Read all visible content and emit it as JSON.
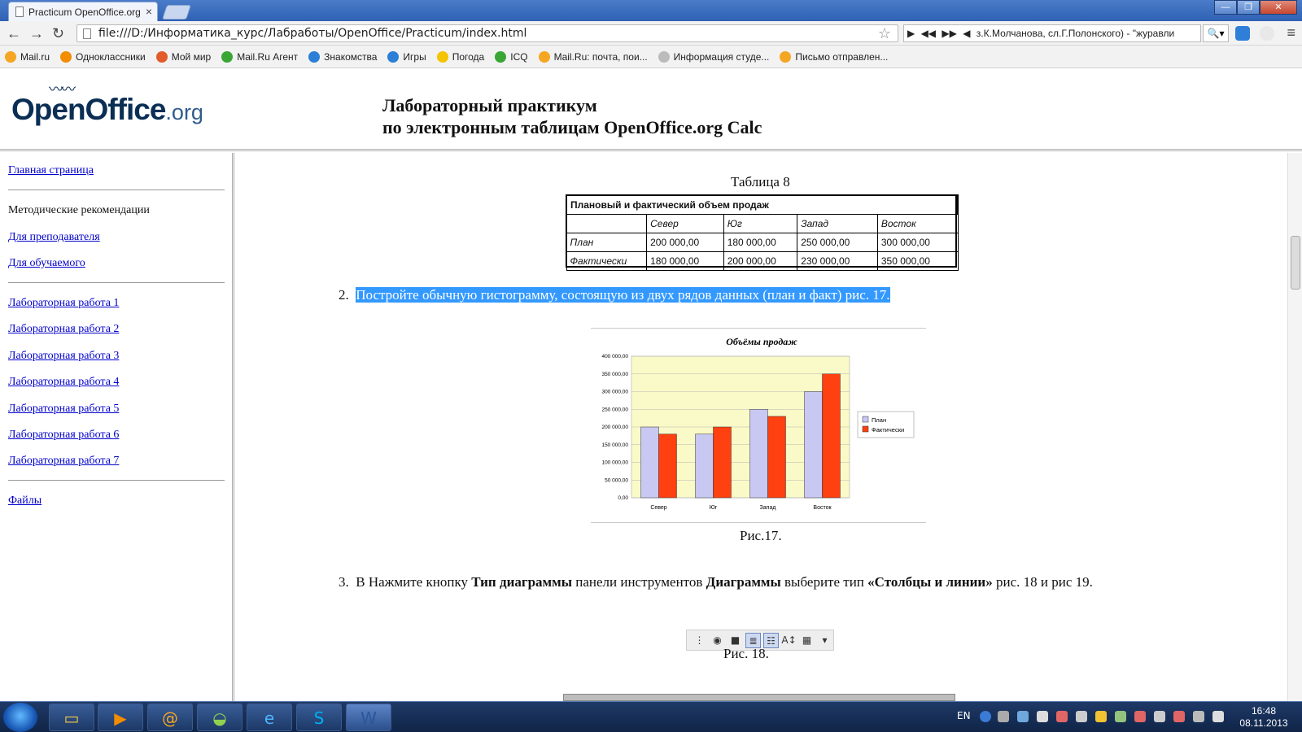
{
  "browser": {
    "tab_title": "Practicum OpenOffice.org",
    "url": "file:///D:/Информатика_курс/Лабработы/OpenOffice/Practicum/index.html",
    "media_text": "з.К.Молчанова, сл.Г.Полонского) - \"журавли"
  },
  "bookmarks": [
    {
      "label": "Mail.ru",
      "color": "#f5a623"
    },
    {
      "label": "Одноклассники",
      "color": "#f28c00"
    },
    {
      "label": "Мой мир",
      "color": "#e25c2b"
    },
    {
      "label": "Mail.Ru Агент",
      "color": "#3aa635"
    },
    {
      "label": "Знакомства",
      "color": "#2b7fd6"
    },
    {
      "label": "Игры",
      "color": "#2b7fd6"
    },
    {
      "label": "Погода",
      "color": "#f5c400"
    },
    {
      "label": "ICQ",
      "color": "#3aa635"
    },
    {
      "label": "Mail.Ru: почта, пои...",
      "color": "#f5a623"
    },
    {
      "label": "Информация студе...",
      "color": "#bbbbbb"
    },
    {
      "label": "Письмо отправлен...",
      "color": "#f5a623"
    }
  ],
  "header": {
    "logo_main": "OpenOffice",
    "logo_suffix": ".org",
    "title_line1": "Лабораторный практикум",
    "title_line2": "по электронным таблицам OpenOffice.org Calc"
  },
  "sidebar": {
    "home": "Главная страница",
    "methodics": "Методические рекомендации",
    "teacher": "Для преподавателя",
    "student": "Для обучаемого",
    "labs": [
      "Лабораторная работа 1",
      "Лабораторная работа 2",
      "Лабораторная работа 3",
      "Лабораторная работа 4",
      "Лабораторная работа 5",
      "Лабораторная работа 6",
      "Лабораторная работа 7"
    ],
    "files": "Файлы"
  },
  "content": {
    "table_caption": "Таблица 8",
    "table": {
      "title": "Плановый и фактический объем продаж",
      "headers": [
        "",
        "Север",
        "Юг",
        "Запад",
        "Восток"
      ],
      "rows": [
        [
          "План",
          "200 000,00",
          "180 000,00",
          "250 000,00",
          "300 000,00"
        ],
        [
          "Фактически",
          "180 000,00",
          "200 000,00",
          "230 000,00",
          "350 000,00"
        ]
      ]
    },
    "step2_num": "2.",
    "step2_text": "Постройте обычную гистограмму, состоящую из двух рядов данных (план и факт) рис. 17.",
    "fig17": "Рис.17.",
    "step3_num": "3.",
    "step3_a": "В Нажмите кнопку",
    "step3_b": "Тип диаграммы",
    "step3_c": "панели инструментов",
    "step3_d": "Диаграммы",
    "step3_e": "выберите тип",
    "step3_f": "«Столбцы и линии»",
    "step3_g": "рис. 18 и рис 19.",
    "fig18": "Рис. 18."
  },
  "chart_data": {
    "type": "bar",
    "title": "Объёмы продаж",
    "categories": [
      "Север",
      "Юг",
      "Запад",
      "Восток"
    ],
    "series": [
      {
        "name": "План",
        "values": [
          200000,
          180000,
          250000,
          300000
        ],
        "color": "#c8c8f2"
      },
      {
        "name": "Фактически",
        "values": [
          180000,
          200000,
          230000,
          350000
        ],
        "color": "#ff4010"
      }
    ],
    "ylim": [
      0,
      400000
    ],
    "yticks": [
      "0,00",
      "50 000,00",
      "100 000,00",
      "150 000,00",
      "200 000,00",
      "250 000,00",
      "300 000,00",
      "350 000,00",
      "400 000,00"
    ],
    "grid": true,
    "legend": "right",
    "plot_background": "#fafac8"
  },
  "taskbar": {
    "lang": "EN",
    "time": "16:48",
    "date": "08.11.2013"
  }
}
